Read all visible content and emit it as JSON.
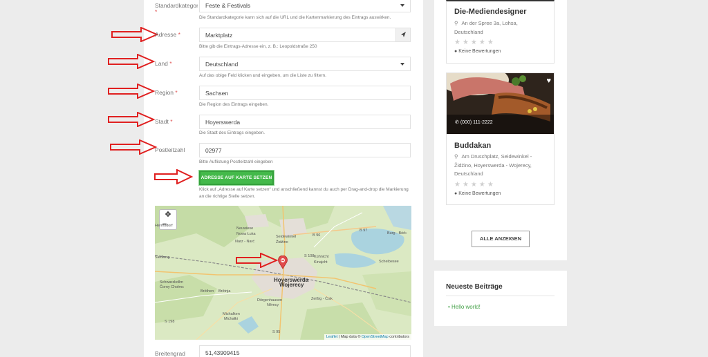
{
  "form": {
    "category": {
      "label": "Standardkategorie",
      "required": "*",
      "value": "Feste & Festivals",
      "hint": "Die Standardkategorie kann sich auf die URL und die Kartenmarkierung des Eintrags auswirken."
    },
    "address": {
      "label": "Adresse",
      "required": "*",
      "value": "Marktplatz",
      "hint": "Bitte gib die Eintrags-Adresse ein, z. B.: Leopoldstraße 250"
    },
    "country": {
      "label": "Land",
      "required": "*",
      "value": "Deutschland",
      "hint": "Auf das obige Feld klicken und eingeben, um die Liste zu filtern."
    },
    "region": {
      "label": "Region",
      "required": "*",
      "value": "Sachsen",
      "hint": "Die Region des Eintrags eingeben."
    },
    "city": {
      "label": "Stadt",
      "required": "*",
      "value": "Hoyerswerda",
      "hint": "Die Stadt des Eintrags eingeben."
    },
    "zip": {
      "label": "Postleitzahl",
      "value": "02977",
      "hint": "Bitte Auflistung Postleitzahl eingeben"
    },
    "set_address_button": "ADRESSE AUF KARTE SETZEN",
    "set_address_hint_1": "Klick auf „Adresse auf Karte setzen“ und anschließend kannst du auch per Drag-and-drop die Markierung",
    "set_address_hint_2": "an die richtige Stelle setzen.",
    "latitude": {
      "label": "Breitengrad",
      "value": "51,43909415"
    }
  },
  "map": {
    "zoom_out": "−",
    "attribution_leaflet": "Leaflet",
    "attribution_mid": " | Map data © ",
    "attribution_osm": "OpenStreetMap",
    "attribution_end": " contributors",
    "places": [
      "Hermsdorf",
      "Neuwiese",
      "Nowa Łuka",
      "Seidewinkel",
      "Židźino",
      "Narz - Narć",
      "Siedlung",
      "Kühnicht",
      "Kinajcht",
      "Schwarzkollm",
      "Čorny Chołmc",
      "Hoyerswerda",
      "Wojerecy",
      "Bröthen",
      "Brětnja",
      "Dörgenhausen",
      "Němcy",
      "Michalken",
      "Michałki",
      "Zeißig - Ćisk",
      "Burg - Bórk",
      "Scheibesee",
      "S 198",
      "S 95",
      "B 96",
      "B 97",
      "S 108"
    ]
  },
  "sidebar": {
    "card1": {
      "title": "Die-Mediendesigner",
      "address_1": "An der Spree 3a, Lohsa,",
      "address_2": "Deutschland",
      "stars": "★★★★★",
      "reviews": "Keine Bewertungen"
    },
    "card2": {
      "phone": "(000) 111-2222",
      "title": "Buddakan",
      "address_1": "Am Druschplatz, Seidewinkel -",
      "address_2": "Židźino, Hoyerswerda - Wojerecy,",
      "address_3": "Deutschland",
      "stars": "★★★★★",
      "reviews": "Keine Bewertungen"
    },
    "show_all": "ALLE ANZEIGEN",
    "recent_title": "Neueste Beiträge",
    "recent_item": "Hello world!"
  }
}
